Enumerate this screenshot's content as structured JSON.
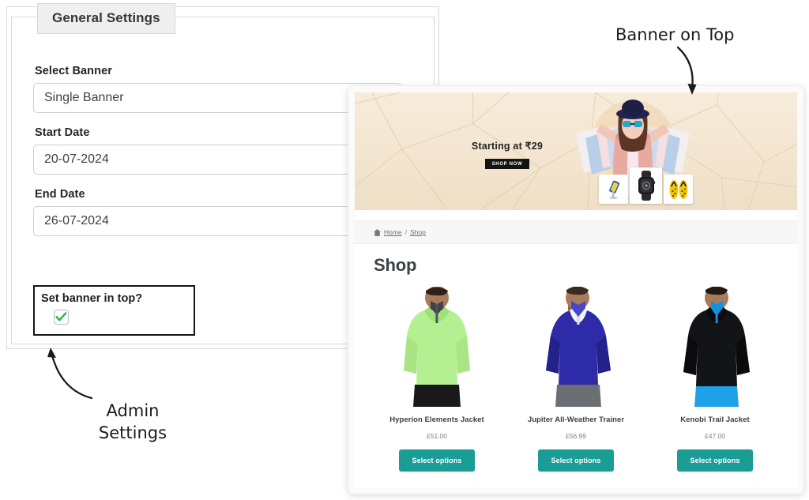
{
  "admin": {
    "tab_label": "General Settings",
    "fields": [
      {
        "label": "Select Banner",
        "value": "Single Banner",
        "name": "select-banner"
      },
      {
        "label": "Start Date",
        "value": "20-07-2024",
        "name": "start-date"
      },
      {
        "label": "End Date",
        "value": "26-07-2024",
        "name": "end-date"
      }
    ],
    "checkbox": {
      "label": "Set banner in top?",
      "checked": true,
      "check_color": "#2db34a"
    }
  },
  "shop": {
    "banner": {
      "headline": "Starting at ₹29",
      "cta_label": "SHOP NOW",
      "background_color": "#f3e5d0",
      "cta_background": "#141414"
    },
    "breadcrumb": {
      "home_icon": "home-icon",
      "home_label": "Home",
      "separator": "/",
      "current_label": "Shop"
    },
    "page_title": "Shop",
    "products": [
      {
        "name": "Hyperion Elements Jacket",
        "price": "£51.00",
        "button_label": "Select options",
        "jacket_color": "#b4ef91",
        "jacket_shade": "#9ee07a",
        "collar_color": "#3d4347",
        "pants_color": "#19191b"
      },
      {
        "name": "Jupiter All-Weather Trainer",
        "price": "£56.99",
        "button_label": "Select options",
        "jacket_color": "#2d2ba8",
        "jacket_shade": "#23218c",
        "collar_color": "#4a48c4",
        "pants_color": "#6b6f74"
      },
      {
        "name": "Kenobi Trail Jacket",
        "price": "£47.00",
        "button_label": "Select options",
        "jacket_color": "#131417",
        "jacket_shade": "#0b0b0d",
        "collar_color": "#1390e0",
        "pants_color": "#1f9fe8"
      }
    ],
    "accent_color": "#1a9d95"
  },
  "annotations": {
    "banner_on_top": "Banner on Top",
    "admin_settings_line1": "Admin",
    "admin_settings_line2": "Settings"
  }
}
